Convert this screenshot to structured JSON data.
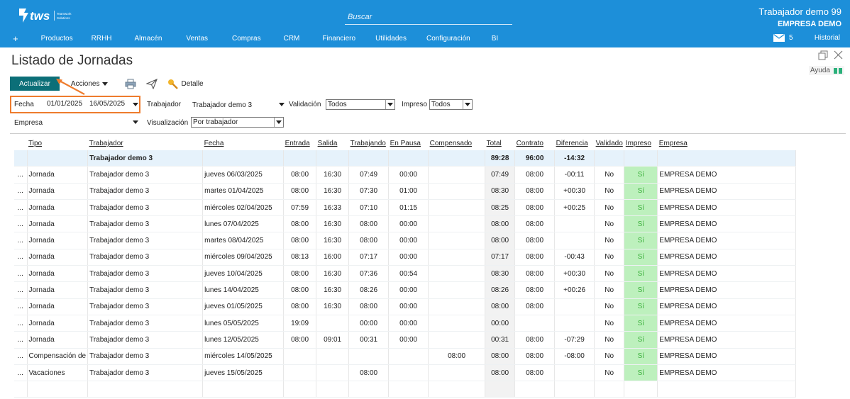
{
  "brand": {
    "name": "tws",
    "tagline": "Teamwork Solutions"
  },
  "search": {
    "placeholder": "Buscar"
  },
  "user": {
    "name": "Trabajador demo 99",
    "company": "EMPRESA DEMO"
  },
  "nav": {
    "plus": "+",
    "items": [
      "Productos",
      "RRHH",
      "Almacén",
      "Ventas",
      "Compras",
      "CRM",
      "Financiero",
      "Utilidades",
      "Configuración",
      "BI"
    ]
  },
  "mail": {
    "icon": "mail-icon",
    "count": "5"
  },
  "history": "Historial",
  "page": {
    "title": "Listado de Jornadas"
  },
  "help": {
    "label": "Ayuda",
    "icon": "book-icon"
  },
  "toolbar": {
    "update": "Actualizar",
    "actions": "Acciones",
    "print_icon": "printer-icon",
    "send_icon": "send-icon",
    "detail": "Detalle",
    "detail_icon": "detail-icon"
  },
  "filters": {
    "date_label": "Fecha",
    "date_from": "01/01/2025",
    "date_to": "16/05/2025",
    "worker_label": "Trabajador",
    "worker_value": "Trabajador demo 3",
    "validation_label": "Validación",
    "validation_value": "Todos",
    "printed_label": "Impreso",
    "printed_value": "Todos",
    "company_label": "Empresa",
    "company_value": "",
    "view_label": "Visualización",
    "view_value": "Por trabajador"
  },
  "table": {
    "headers": [
      "Tipo",
      "Trabajador",
      "Fecha",
      "Entrada",
      "Salida",
      "Trabajando",
      "En Pausa",
      "Compensado",
      "Total",
      "Contrato",
      "Diferencia",
      "Validado",
      "Impreso",
      "Empresa"
    ],
    "total_row": {
      "worker": "Trabajador demo 3",
      "total": "89:28",
      "contract": "96:00",
      "difference": "-14:32"
    },
    "rows": [
      {
        "more": "...",
        "type": "Jornada",
        "worker": "Trabajador demo 3",
        "date": "jueves 06/03/2025",
        "in": "08:00",
        "out": "16:30",
        "working": "07:49",
        "pause": "00:00",
        "comp": "",
        "total": "07:49",
        "contract": "08:00",
        "diff": "-00:11",
        "validated": "No",
        "printed": "Sí",
        "company": "EMPRESA DEMO"
      },
      {
        "more": "...",
        "type": "Jornada",
        "worker": "Trabajador demo 3",
        "date": "martes 01/04/2025",
        "in": "08:00",
        "out": "16:30",
        "working": "07:30",
        "pause": "01:00",
        "comp": "",
        "total": "08:30",
        "contract": "08:00",
        "diff": "+00:30",
        "validated": "No",
        "printed": "Sí",
        "company": "EMPRESA DEMO"
      },
      {
        "more": "...",
        "type": "Jornada",
        "worker": "Trabajador demo 3",
        "date": "miércoles 02/04/2025",
        "in": "07:59",
        "out": "16:33",
        "working": "07:10",
        "pause": "01:15",
        "comp": "",
        "total": "08:25",
        "contract": "08:00",
        "diff": "+00:25",
        "validated": "No",
        "printed": "Sí",
        "company": "EMPRESA DEMO"
      },
      {
        "more": "...",
        "type": "Jornada",
        "worker": "Trabajador demo 3",
        "date": "lunes 07/04/2025",
        "in": "08:00",
        "out": "16:30",
        "working": "08:00",
        "pause": "00:00",
        "comp": "",
        "total": "08:00",
        "contract": "08:00",
        "diff": "",
        "validated": "No",
        "printed": "Sí",
        "company": "EMPRESA DEMO"
      },
      {
        "more": "...",
        "type": "Jornada",
        "worker": "Trabajador demo 3",
        "date": "martes 08/04/2025",
        "in": "08:00",
        "out": "16:30",
        "working": "08:00",
        "pause": "00:00",
        "comp": "",
        "total": "08:00",
        "contract": "08:00",
        "diff": "",
        "validated": "No",
        "printed": "Sí",
        "company": "EMPRESA DEMO"
      },
      {
        "more": "...",
        "type": "Jornada",
        "worker": "Trabajador demo 3",
        "date": "miércoles 09/04/2025",
        "in": "08:13",
        "out": "16:00",
        "working": "07:17",
        "pause": "00:00",
        "comp": "",
        "total": "07:17",
        "contract": "08:00",
        "diff": "-00:43",
        "validated": "No",
        "printed": "Sí",
        "company": "EMPRESA DEMO"
      },
      {
        "more": "...",
        "type": "Jornada",
        "worker": "Trabajador demo 3",
        "date": "jueves 10/04/2025",
        "in": "08:00",
        "out": "16:30",
        "working": "07:36",
        "pause": "00:54",
        "comp": "",
        "total": "08:30",
        "contract": "08:00",
        "diff": "+00:30",
        "validated": "No",
        "printed": "Sí",
        "company": "EMPRESA DEMO"
      },
      {
        "more": "...",
        "type": "Jornada",
        "worker": "Trabajador demo 3",
        "date": "lunes 14/04/2025",
        "in": "08:00",
        "out": "16:30",
        "working": "08:26",
        "pause": "00:00",
        "comp": "",
        "total": "08:26",
        "contract": "08:00",
        "diff": "+00:26",
        "validated": "No",
        "printed": "Sí",
        "company": "EMPRESA DEMO"
      },
      {
        "more": "...",
        "type": "Jornada",
        "worker": "Trabajador demo 3",
        "date": "jueves 01/05/2025",
        "in": "08:00",
        "out": "16:30",
        "working": "08:00",
        "pause": "00:00",
        "comp": "",
        "total": "08:00",
        "contract": "08:00",
        "diff": "",
        "validated": "No",
        "printed": "Sí",
        "company": "EMPRESA DEMO"
      },
      {
        "more": "...",
        "type": "Jornada",
        "worker": "Trabajador demo 3",
        "date": "lunes 05/05/2025",
        "in": "19:09",
        "out": "",
        "working": "00:00",
        "pause": "00:00",
        "comp": "",
        "total": "00:00",
        "contract": "",
        "diff": "",
        "validated": "No",
        "printed": "Sí",
        "company": "EMPRESA DEMO"
      },
      {
        "more": "...",
        "type": "Jornada",
        "worker": "Trabajador demo 3",
        "date": "lunes 12/05/2025",
        "in": "08:00",
        "out": "09:01",
        "working": "00:31",
        "pause": "00:00",
        "comp": "",
        "total": "00:31",
        "contract": "08:00",
        "diff": "-07:29",
        "validated": "No",
        "printed": "Sí",
        "company": "EMPRESA DEMO"
      },
      {
        "more": "...",
        "type": "Compensación de",
        "worker": "Trabajador demo 3",
        "date": "miércoles 14/05/2025",
        "in": "",
        "out": "",
        "working": "",
        "pause": "",
        "comp": "08:00",
        "total": "08:00",
        "contract": "08:00",
        "diff": "-08:00",
        "validated": "No",
        "printed": "Sí",
        "company": "EMPRESA DEMO"
      },
      {
        "more": "...",
        "type": "Vacaciones",
        "worker": "Trabajador demo 3",
        "date": "jueves 15/05/2025",
        "in": "",
        "out": "",
        "working": "08:00",
        "pause": "",
        "comp": "",
        "total": "08:00",
        "contract": "08:00",
        "diff": "",
        "validated": "No",
        "printed": "Sí",
        "company": "EMPRESA DEMO"
      }
    ]
  },
  "colors": {
    "topbar": "#1d8fd9",
    "update_button": "#0c6f78",
    "highlight": "#ee7c2d",
    "printed_yes_bg": "#bdf0bd",
    "total_row_bg": "#e6f2fb"
  }
}
